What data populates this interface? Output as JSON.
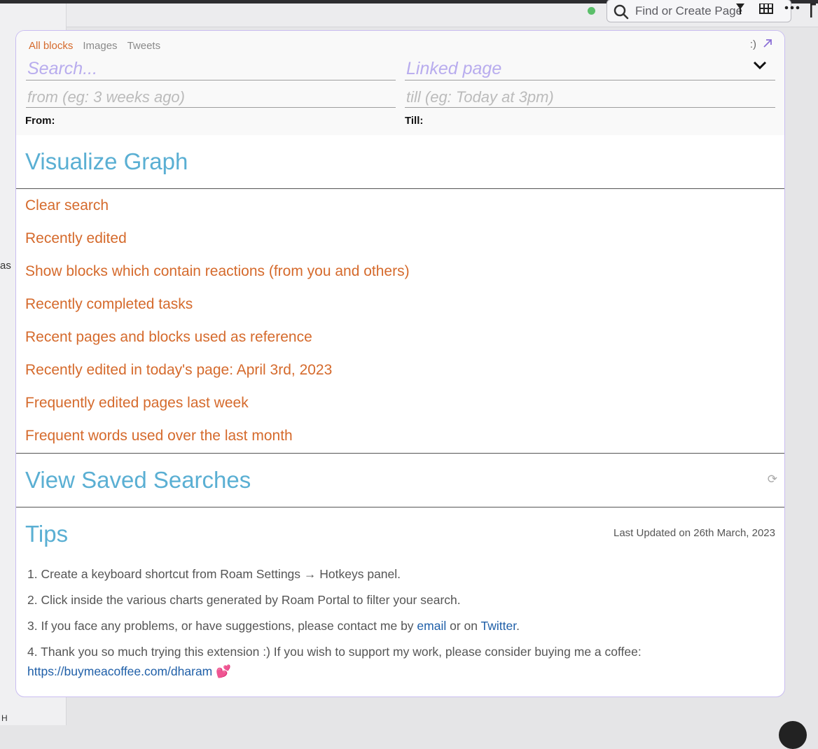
{
  "background": {
    "find_placeholder": "Find or Create Page",
    "side_text": "as",
    "side_text_bottom": "H"
  },
  "panel": {
    "tabs": [
      "All blocks",
      "Images",
      "Tweets"
    ],
    "active_tab": "All blocks",
    "smiley": ":)",
    "search_placeholder": "Search...",
    "linked_placeholder": "Linked page",
    "from_placeholder": "from (eg: 3 weeks ago)",
    "till_placeholder": "till (eg: Today at 3pm)",
    "from_label": "From:",
    "till_label": "Till:",
    "visualize_title": "Visualize Graph",
    "quick_queries": [
      "Clear search",
      "Recently edited",
      "Show blocks which contain reactions (from you and others)",
      "Recently completed tasks",
      "Recent pages and blocks used as reference",
      "Recently edited in today's page: April 3rd, 2023",
      "Frequently edited pages last week",
      "Frequent words used over the last month"
    ],
    "saved_title": "View Saved Searches",
    "tips_title": "Tips",
    "last_updated": "Last Updated on 26th March, 2023",
    "tips": {
      "t1": "1. Create a keyboard shortcut from Roam Settings → Hotkeys panel.",
      "t2": "2. Click inside the various charts generated by Roam Portal to filter your search.",
      "t3_pre": "3. If you face any problems, or have suggestions, please contact me by ",
      "t3_email": "email",
      "t3_mid": " or on ",
      "t3_twitter": "Twitter",
      "t3_end": ".",
      "t4": "4. Thank you so much trying this extension :) If you wish to support my work, please consider buying me a coffee:",
      "t4_link": "https://buymeacoffee.com/dharam"
    }
  },
  "colors": {
    "accent_orange": "#d56a2c",
    "section_blue": "#5aafd3",
    "placeholder_purple": "#b8acee",
    "link_blue": "#1f5fa8",
    "panel_border": "#c9bdf1"
  }
}
